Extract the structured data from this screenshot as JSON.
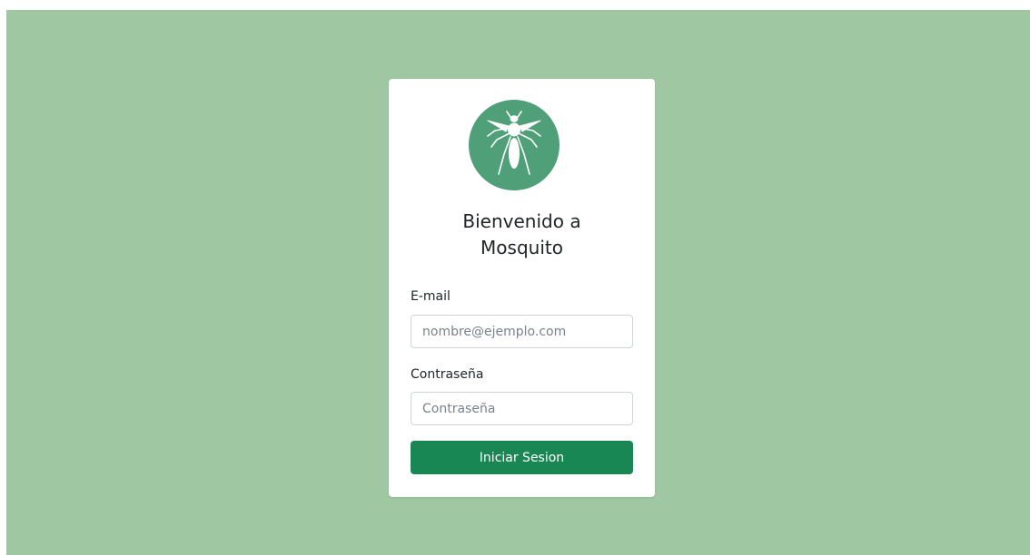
{
  "colors": {
    "backdrop": "#9fc8a2",
    "logo_circle": "#4f9f78",
    "primary_button": "#198754"
  },
  "login": {
    "logo_icon": "mosquito-icon",
    "title_line1": "Bienvenido a",
    "title_line2": "Mosquito",
    "email_label": "E-mail",
    "email_placeholder": "nombre@ejemplo.com",
    "email_value": "",
    "password_label": "Contraseña",
    "password_placeholder": "Contraseña",
    "password_value": "",
    "submit_label": "Iniciar Sesion"
  }
}
